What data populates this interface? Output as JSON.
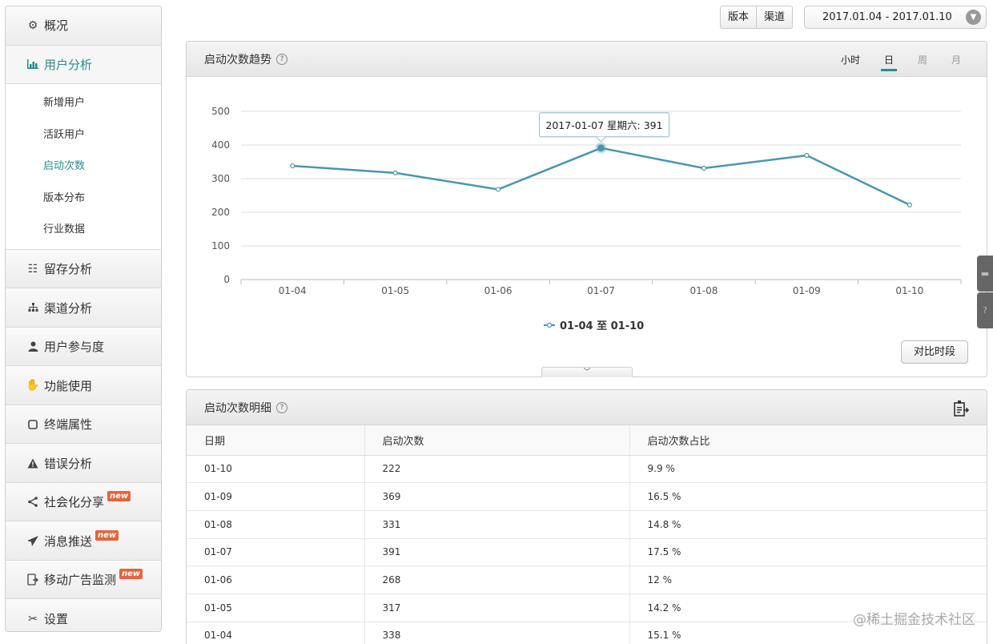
{
  "sidebar": {
    "items": [
      {
        "label": "概况",
        "icon": "gears-icon"
      },
      {
        "label": "用户分析",
        "icon": "bar-chart-icon",
        "active": true
      },
      {
        "label": "留存分析",
        "icon": "grid-icon"
      },
      {
        "label": "渠道分析",
        "icon": "org-tree-icon"
      },
      {
        "label": "用户参与度",
        "icon": "person-icon"
      },
      {
        "label": "功能使用",
        "icon": "hand-icon"
      },
      {
        "label": "终端属性",
        "icon": "device-icon"
      },
      {
        "label": "错误分析",
        "icon": "warning-icon"
      },
      {
        "label": "社会化分享",
        "icon": "share-icon",
        "badge": "new"
      },
      {
        "label": "消息推送",
        "icon": "send-icon",
        "badge": "new"
      },
      {
        "label": "移动广告监测",
        "icon": "ad-monitor-icon",
        "badge": "new"
      },
      {
        "label": "设置",
        "icon": "tools-icon"
      }
    ],
    "sub_items": [
      "新增用户",
      "活跃用户",
      "启动次数",
      "版本分布",
      "行业数据"
    ],
    "current_sub": "启动次数"
  },
  "toolbar": {
    "version_label": "版本",
    "channel_label": "渠道",
    "date_range": "2017.01.04 - 2017.01.10"
  },
  "trend_panel": {
    "title": "启动次数趋势",
    "help": "?",
    "periods": [
      "小时",
      "日",
      "周",
      "月"
    ],
    "selected_period": "日",
    "compare_button": "对比时段",
    "tooltip": "2017-01-07 星期六: 391"
  },
  "chart_data": {
    "type": "line",
    "categories": [
      "01-04",
      "01-05",
      "01-06",
      "01-07",
      "01-08",
      "01-09",
      "01-10"
    ],
    "series": [
      {
        "name": "01-04 至 01-10",
        "values": [
          338,
          317,
          268,
          391,
          331,
          369,
          222
        ]
      }
    ],
    "ylim": [
      0,
      500
    ],
    "yticks": [
      0,
      100,
      200,
      300,
      400,
      500
    ],
    "grid": true,
    "legend_position": "bottom-center",
    "highlight_index": 3,
    "colors": {
      "line": "#4a97ad",
      "grid": "#dcdcdc"
    }
  },
  "detail_panel": {
    "title": "启动次数明细",
    "help": "?",
    "columns": [
      "日期",
      "启动次数",
      "启动次数占比"
    ],
    "rows": [
      [
        "01-10",
        "222",
        "9.9 %"
      ],
      [
        "01-09",
        "369",
        "16.5 %"
      ],
      [
        "01-08",
        "331",
        "14.8 %"
      ],
      [
        "01-07",
        "391",
        "17.5 %"
      ],
      [
        "01-06",
        "268",
        "12 %"
      ],
      [
        "01-05",
        "317",
        "14.2 %"
      ],
      [
        "01-04",
        "338",
        "15.1 %"
      ]
    ]
  },
  "watermark": "@稀土掘金技术社区",
  "colors": {
    "accent": "#2c8c8c",
    "badge": "#e8643c"
  }
}
